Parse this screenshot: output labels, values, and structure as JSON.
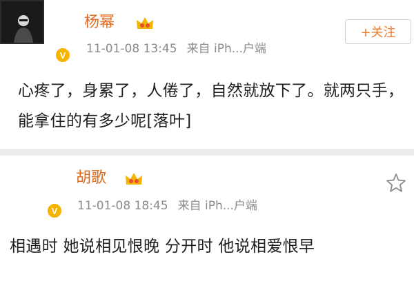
{
  "posts": [
    {
      "username": "杨幂",
      "time": "11-01-08 13:45",
      "source": "来自 iPh...户端",
      "follow_label": "+关注",
      "content": "心疼了，身累了，人倦了，自然就放下了。就两只手，能拿住的有多少呢[落叶]",
      "verified_badge": "V",
      "accent_color": "#e06a1d"
    },
    {
      "username": "胡歌",
      "time": "11-01-08 18:45",
      "source": "来自 iPh...户端",
      "content": "相遇时 她说相见恨晚 分开时 他说相爱恨早",
      "verified_badge": "V",
      "icon": "star-icon"
    }
  ]
}
